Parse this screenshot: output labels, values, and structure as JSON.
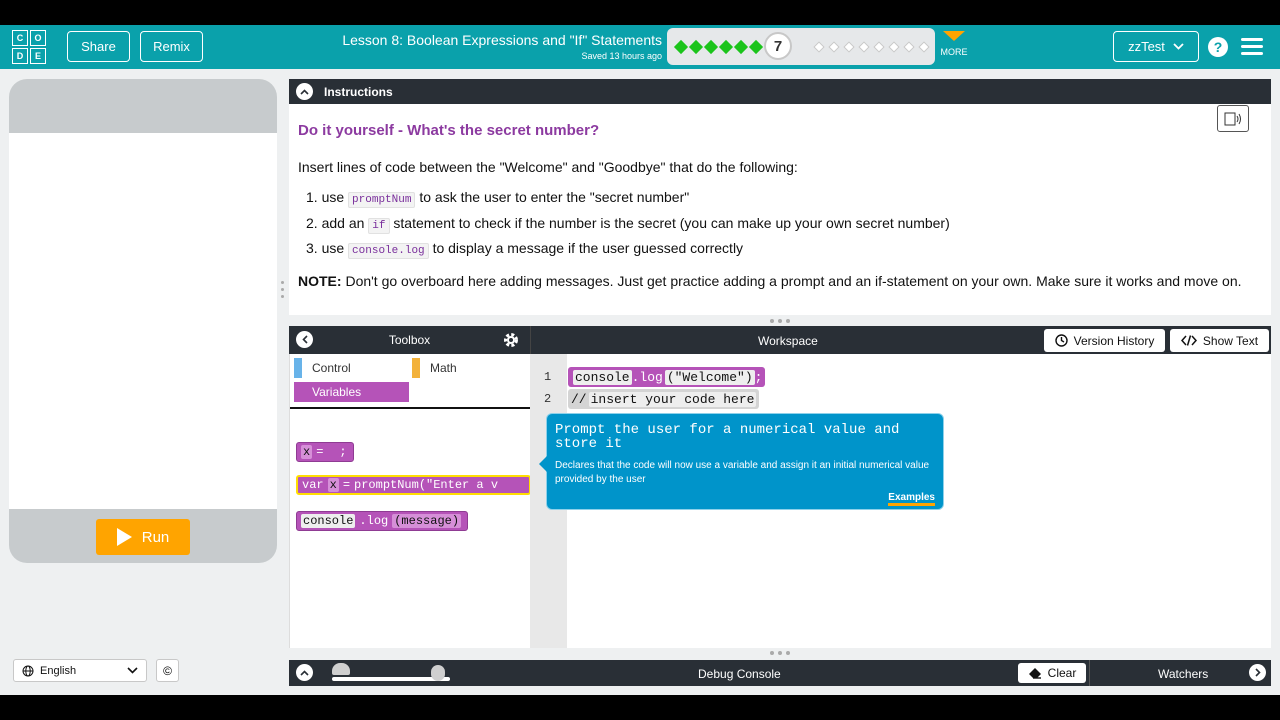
{
  "header": {
    "logo_letters": [
      "C",
      "O",
      "D",
      "E"
    ],
    "share_label": "Share",
    "remix_label": "Remix",
    "lesson_title": "Lesson 8: Boolean Expressions and \"If\" Statements",
    "saved_text": "Saved 13 hours ago",
    "progress": {
      "completed": 6,
      "current": "7",
      "remaining": 8
    },
    "more_label": "MORE",
    "user_label": "zzTest",
    "help_label": "?"
  },
  "app": {
    "run_label": "Run",
    "language": "English",
    "cc_label": "©"
  },
  "instructions": {
    "header": "Instructions",
    "title": "Do it yourself - What's the secret number?",
    "intro": "Insert lines of code between the \"Welcome\" and \"Goodbye\" that do the following:",
    "items": [
      {
        "num": "1.",
        "pre": "use",
        "code": "promptNum",
        "post": "to ask the user to enter the \"secret number\""
      },
      {
        "num": "2.",
        "pre": "add an",
        "code": "if",
        "post": "statement to check if the number is the secret (you can make up your own secret number)"
      },
      {
        "num": "3.",
        "pre": "use",
        "code": "console.log",
        "post": "to display a message if the user guessed correctly"
      }
    ],
    "note_label": "NOTE:",
    "note_text": "Don't go overboard here adding messages. Just get practice adding a prompt and an if-statement on your own. Make sure it works and move on."
  },
  "toolbox": {
    "title": "Toolbox",
    "categories": [
      {
        "label": "Control",
        "color": "#68b3e9"
      },
      {
        "label": "Math",
        "color": "#f3b23b"
      }
    ],
    "selected_category": "Variables",
    "blocks": [
      {
        "parts": [
          "x",
          "=",
          "",
          ";"
        ]
      },
      {
        "parts": [
          "var",
          "x",
          "=",
          "promptNum(\"Enter a v"
        ]
      },
      {
        "parts": [
          "console",
          ".log",
          "(message)"
        ]
      }
    ]
  },
  "workspace": {
    "title": "Workspace",
    "version_history_label": "Version History",
    "show_text_label": "Show Text",
    "lines": [
      {
        "num": "1",
        "fn": "console",
        "rest": ".log",
        "arg": "(\"Welcome\")",
        "end": ";"
      },
      {
        "num": "2",
        "comment_mark": "//",
        "comment": "insert your code here"
      }
    ]
  },
  "tooltip": {
    "title": "Prompt the user for a numerical value and store it",
    "description": "Declares that the code will now use a variable and assign it an initial numerical value provided by the user",
    "examples_label": "Examples"
  },
  "debug": {
    "title": "Debug Console",
    "clear_label": "Clear",
    "watchers_label": "Watchers"
  },
  "colors": {
    "header": "#0aa1ab",
    "variables_block": "#b553b8",
    "tooltip": "#0094ca",
    "run_button": "#ffa400",
    "dark_bar": "#292f36",
    "title_purple": "#8c3aa0"
  }
}
